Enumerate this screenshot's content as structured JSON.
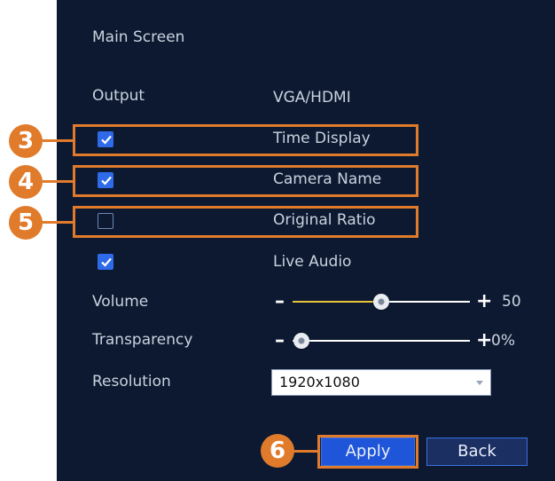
{
  "main_screen": {
    "title": "Main Screen"
  },
  "output": {
    "label": "Output",
    "value": "VGA/HDMI"
  },
  "options": [
    {
      "label": "Time Display",
      "checked": true,
      "callout": "3"
    },
    {
      "label": "Camera Name",
      "checked": true,
      "callout": "4"
    },
    {
      "label": "Original Ratio",
      "checked": false,
      "callout": "5"
    },
    {
      "label": "Live Audio",
      "checked": true
    }
  ],
  "volume": {
    "label": "Volume",
    "minus": "–",
    "plus": "+",
    "value_text": "50",
    "value": 50
  },
  "transparency": {
    "label": "Transparency",
    "minus": "–",
    "plus": "+",
    "value_text": "0%",
    "value": 0
  },
  "resolution": {
    "label": "Resolution",
    "value": "1920x1080"
  },
  "buttons": {
    "apply": "Apply",
    "back": "Back",
    "apply_callout": "6"
  },
  "colors": {
    "background": "#0d1931",
    "accent": "#e07b2c",
    "checkbox": "#2f6ae8",
    "apply": "#1f55d8"
  }
}
